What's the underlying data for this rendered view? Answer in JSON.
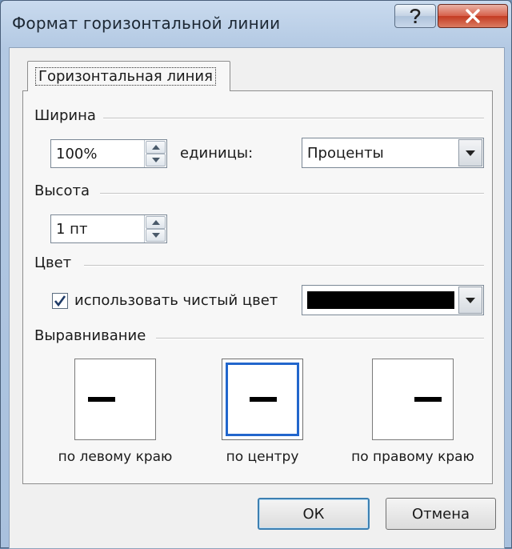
{
  "window": {
    "title": "Формат горизонтальной линии",
    "help_icon": "question-mark-icon",
    "close_icon": "close-x-icon"
  },
  "tab": {
    "label": "Горизонтальная линия"
  },
  "width": {
    "section_label": "Ширина",
    "value": "100%",
    "units_label": "единицы:",
    "units_value": "Проценты"
  },
  "height": {
    "section_label": "Высота",
    "value": "1 пт"
  },
  "color": {
    "section_label": "Цвет",
    "checkbox_label": "использовать чистый цвет",
    "checkbox_checked": true,
    "swatch_color": "#000000"
  },
  "alignment": {
    "section_label": "Выравнивание",
    "options": [
      {
        "label": "по левому краю",
        "selected": false
      },
      {
        "label": "по центру",
        "selected": true
      },
      {
        "label": "по правому краю",
        "selected": false
      }
    ]
  },
  "buttons": {
    "ok": "ОК",
    "cancel": "Отмена"
  }
}
